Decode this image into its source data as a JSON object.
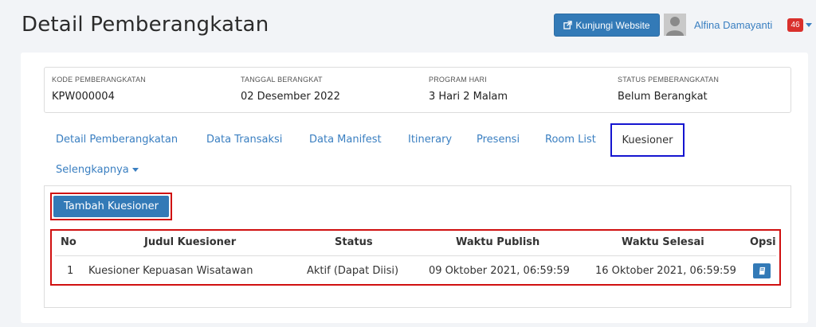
{
  "page_title": "Detail Pemberangkatan",
  "header": {
    "visit_button": "Kunjungi Website",
    "user_name": "Alfina Damayanti",
    "notification_count": "46"
  },
  "info": [
    {
      "label": "KODE PEMBERANGKATAN",
      "value": "KPW000004"
    },
    {
      "label": "TANGGAL BERANGKAT",
      "value": "02 Desember 2022"
    },
    {
      "label": "PROGRAM HARI",
      "value": "3 Hari 2 Malam"
    },
    {
      "label": "STATUS PEMBERANGKATAN",
      "value": "Belum Berangkat"
    }
  ],
  "tabs": [
    {
      "label": "Detail Pemberangkatan"
    },
    {
      "label": "Data Transaksi"
    },
    {
      "label": "Data Manifest"
    },
    {
      "label": "Itinerary"
    },
    {
      "label": "Presensi"
    },
    {
      "label": "Room List"
    },
    {
      "label": "Kuesioner",
      "active": true
    },
    {
      "label": "Selengkapnya"
    }
  ],
  "add_button": "Tambah Kuesioner",
  "table": {
    "headers": [
      "No",
      "Judul Kuesioner",
      "Status",
      "Waktu Publish",
      "Waktu Selesai",
      "Opsi"
    ],
    "rows": [
      {
        "no": "1",
        "title": "Kuesioner Kepuasan Wisatawan",
        "status": "Aktif (Dapat Diisi)",
        "publish": "09 Oktober 2021, 06:59:59",
        "end": "16 Oktober 2021, 06:59:59"
      }
    ]
  },
  "colors": {
    "primary": "#337ab7",
    "highlight_red": "#d01010",
    "highlight_blue": "#1515d0",
    "badge": "#d9302c"
  }
}
